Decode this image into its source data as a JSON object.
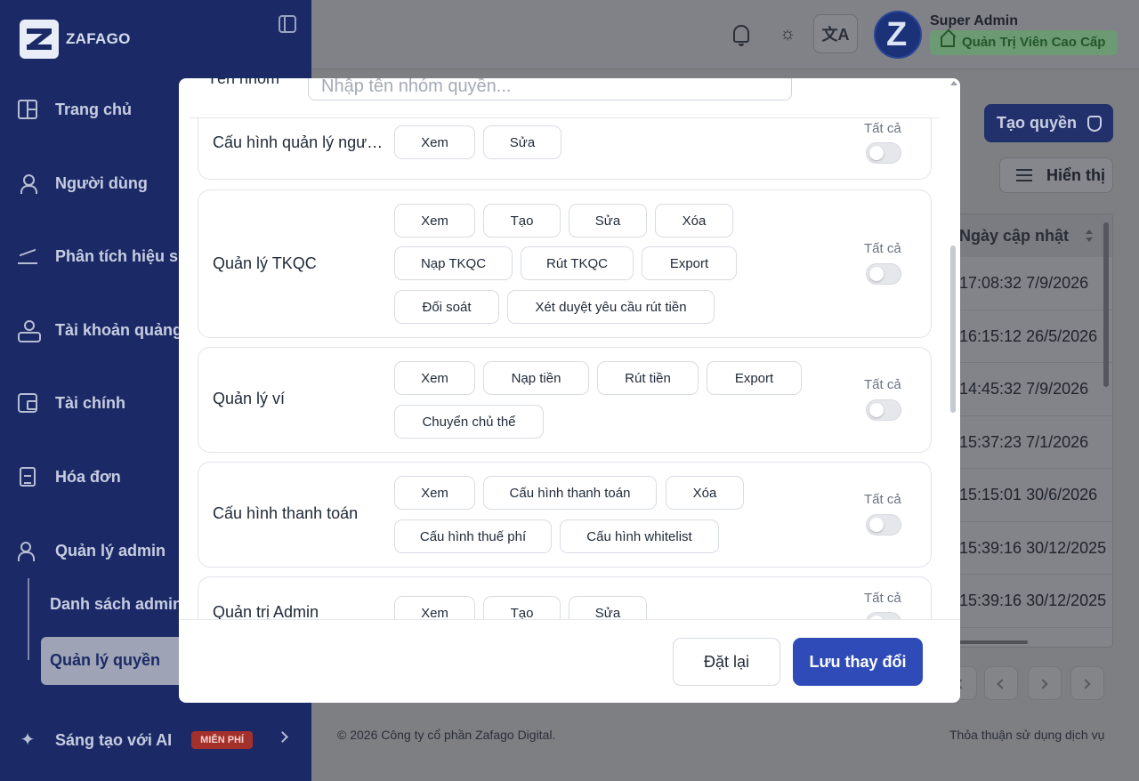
{
  "brand": {
    "name": "ZAFAGO"
  },
  "sidebar": {
    "items": [
      {
        "label": "Trang chủ",
        "icon": "dashboard-icon"
      },
      {
        "label": "Người dùng",
        "icon": "user-icon"
      },
      {
        "label": "Phân tích hiệu suấ",
        "icon": "chart-icon"
      },
      {
        "label": "Tài khoản quảng c",
        "icon": "ad-account-icon"
      },
      {
        "label": "Tài chính",
        "icon": "wallet-icon"
      },
      {
        "label": "Hóa đơn",
        "icon": "invoice-icon"
      },
      {
        "label": "Quản lý admin",
        "icon": "users-icon"
      }
    ],
    "sub_items": [
      {
        "label": "Danh sách admin"
      },
      {
        "label": "Quản lý quyền",
        "active": true
      }
    ],
    "ai_item": {
      "label": "Sáng tạo với AI",
      "badge": "MIỄN PHÍ",
      "icon": "sparkle-icon"
    }
  },
  "header": {
    "user_name": "Super Admin",
    "user_role": "Quản Trị Viên Cao Cấp"
  },
  "page": {
    "create_button": "Tạo quyền",
    "display_button": "Hiển thị",
    "table": {
      "column": "Ngày cập nhật",
      "rows": [
        "17:08:32 7/9/2026",
        "16:15:12 26/5/2026",
        "14:45:32 7/9/2026",
        "15:37:23 7/1/2026",
        "15:15:01 30/6/2026",
        "15:39:16 30/12/2025",
        "15:39:16 30/12/2025"
      ]
    },
    "footer_left": "© 2026 Công ty cổ phần Zafago Digital.",
    "footer_right": "Thỏa thuận sử dụng dịch vụ"
  },
  "modal": {
    "group_name_label": "Tên nhóm *",
    "group_name_placeholder": "Nhập tên nhóm quyền...",
    "all_label": "Tất cả",
    "sections": [
      {
        "title": "Cấu hình quản lý người dùng",
        "perms": [
          "Xem",
          "Sửa"
        ]
      },
      {
        "title": "Quản lý TKQC",
        "perms": [
          "Xem",
          "Tạo",
          "Sửa",
          "Xóa",
          "Nạp TKQC",
          "Rút TKQC",
          "Export",
          "Đối soát",
          "Xét duyệt yêu cầu rút tiền"
        ]
      },
      {
        "title": "Quản lý ví",
        "perms": [
          "Xem",
          "Nạp tiền",
          "Rút tiền",
          "Export",
          "Chuyển chủ thể"
        ]
      },
      {
        "title": "Cấu hình thanh toán",
        "perms": [
          "Xem",
          "Cấu hình thanh toán",
          "Xóa",
          "Cấu hình thuế phí",
          "Cấu hình whitelist"
        ]
      },
      {
        "title": "Quản trị Admin",
        "perms": [
          "Xem",
          "Tạo",
          "Sửa"
        ]
      }
    ],
    "reset_button": "Đặt lại",
    "save_button": "Lưu thay đổi"
  }
}
